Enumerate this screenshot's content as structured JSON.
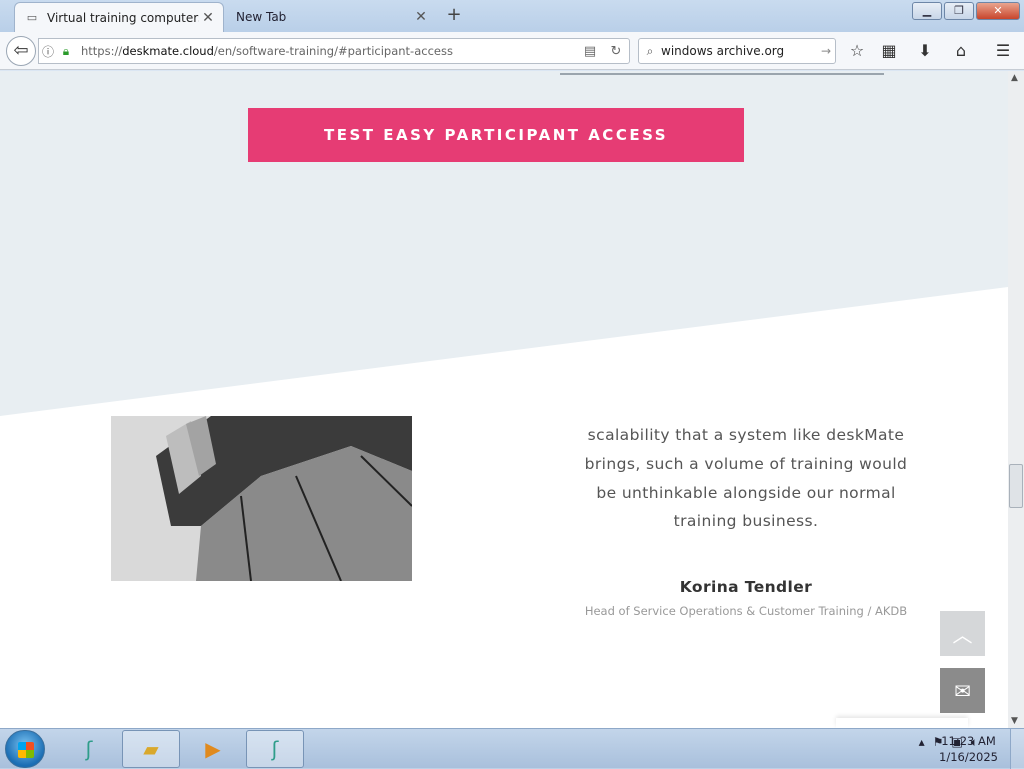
{
  "browser": {
    "tabs": [
      {
        "title": "Virtual training computers fo",
        "active": true
      },
      {
        "title": "New Tab",
        "active": false
      }
    ],
    "new_tab": "+",
    "url_prefix": "https://",
    "url_host": "deskmate.cloud",
    "url_path": "/en/software-training/#participant-access",
    "search_value": "windows archive.org"
  },
  "page": {
    "cta_label": "TEST EASY PARTICIPANT ACCESS",
    "quote": "scalability that a system like deskMate brings, such a volume of training would be unthinkable alongside our normal training business.",
    "author": "Korina Tendler",
    "role": "Head of Service Operations & Customer Training / AKDB"
  },
  "taskbar": {
    "time": "11:23 AM",
    "date": "1/16/2025"
  },
  "colors": {
    "cta": "#e63c74",
    "section_bg": "#e8eef2"
  }
}
